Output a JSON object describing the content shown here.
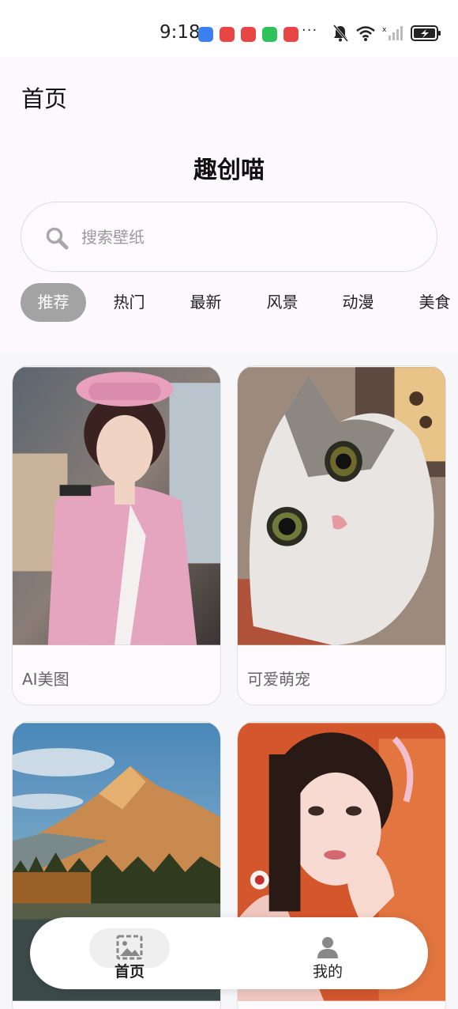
{
  "status_bar": {
    "time": "9:18",
    "more": "···",
    "app_icon_colors": [
      "#3b7ff0",
      "#e84545",
      "#e84545",
      "#2fc25b",
      "#e84545"
    ]
  },
  "header": {
    "page_title": "首页",
    "app_title": "趣创喵"
  },
  "search": {
    "placeholder": "搜索壁纸",
    "icon": "search-icon"
  },
  "tabs": [
    {
      "label": "推荐",
      "active": true
    },
    {
      "label": "热门",
      "active": false
    },
    {
      "label": "最新",
      "active": false
    },
    {
      "label": "风景",
      "active": false
    },
    {
      "label": "动漫",
      "active": false
    },
    {
      "label": "美食",
      "active": false
    }
  ],
  "cards": [
    {
      "label": "AI美图",
      "image": "girl-pink-uniform-photo"
    },
    {
      "label": "可爱萌宠",
      "image": "cat-photo"
    },
    {
      "label": "",
      "image": "mountain-landscape-photo"
    },
    {
      "label": "",
      "image": "girl-orange-background-photo"
    }
  ],
  "bottom_nav": [
    {
      "label": "首页",
      "icon": "image-icon",
      "active": true
    },
    {
      "label": "我的",
      "icon": "person-icon",
      "active": false
    }
  ],
  "colors": {
    "header_bg": "#fcf8fc",
    "active_tab_bg": "#a3a3a3",
    "page_bg": "#f7f7f9"
  }
}
